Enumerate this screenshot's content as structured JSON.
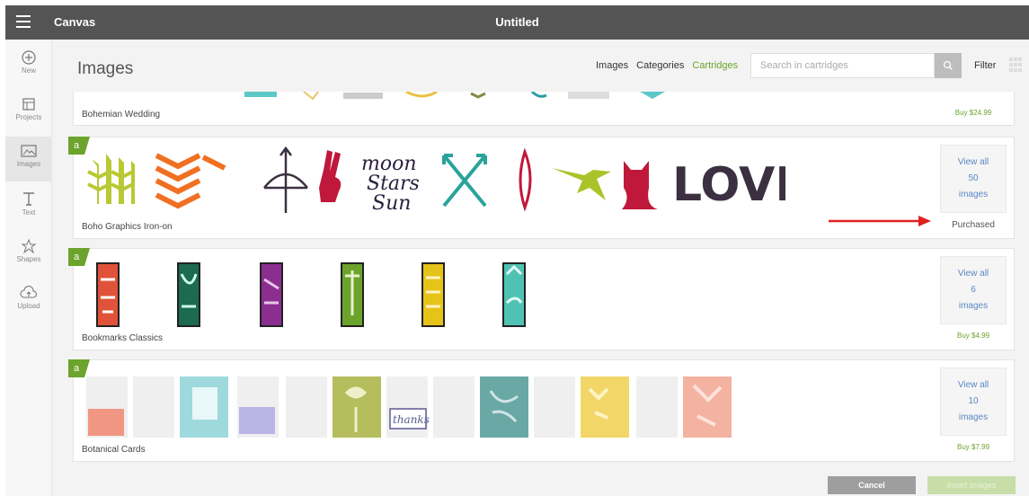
{
  "topbar": {
    "app_title": "Canvas",
    "document_title": "Untitled"
  },
  "rail": [
    {
      "id": "new",
      "label": "New",
      "icon": "plus-circle-icon"
    },
    {
      "id": "projects",
      "label": "Projects",
      "icon": "projects-icon"
    },
    {
      "id": "images",
      "label": "Images",
      "icon": "images-icon"
    },
    {
      "id": "text",
      "label": "Text",
      "icon": "text-icon"
    },
    {
      "id": "shapes",
      "label": "Shapes",
      "icon": "shapes-icon"
    },
    {
      "id": "upload",
      "label": "Upload",
      "icon": "upload-icon"
    }
  ],
  "header": {
    "title": "Images",
    "tabs": [
      "Images",
      "Categories",
      "Cartridges"
    ],
    "active_tab": "Cartridges",
    "search_placeholder": "Search in cartridges",
    "filter_label": "Filter"
  },
  "cartridges": [
    {
      "name": "Bohemian Wedding",
      "buy": "Buy $24.99"
    },
    {
      "name": "Boho Graphics Iron-on",
      "view_top": "View all",
      "count": "50",
      "view_bottom": "images",
      "status": "Purchased"
    },
    {
      "name": "Bookmarks Classics",
      "view_top": "View all",
      "count": "6",
      "view_bottom": "images",
      "buy": "Buy $4.99"
    },
    {
      "name": "Botanical Cards",
      "view_top": "View all",
      "count": "10",
      "view_bottom": "images",
      "buy": "Buy $7.99"
    }
  ],
  "boho_art_text": {
    "moon": "moon",
    "stars": "Stars",
    "sun": "Sun",
    "love": "LOVE"
  },
  "card_art_text": {
    "thanks": "thanks"
  },
  "footer": {
    "cancel_label": "Cancel",
    "insert_label": "Insert Images"
  },
  "colors": {
    "accent_green": "#6ca32c",
    "link_blue": "#5a87c5",
    "topbar": "#545454",
    "arrow_red": "#e02020"
  }
}
